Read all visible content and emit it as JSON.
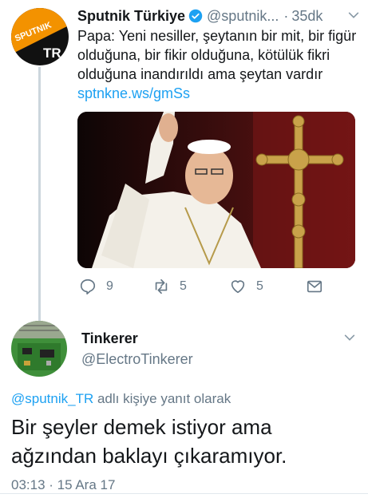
{
  "tweet1": {
    "name": "Sputnik Türkiye",
    "handle": "@sputnik...",
    "time": "35dk",
    "text_main": "Papa: Yeni nesiller, şeytanın bir mit, bir figür olduğuna, bir fikir olduğuna, kötülük fikri olduğuna inandırıldı ama şeytan vardır ",
    "link": "sptnkne.ws/gmSs",
    "avatar_logo_text": "SPUTNIK",
    "avatar_tr": "TR",
    "replies": "9",
    "retweets": "5",
    "likes": "5"
  },
  "tweet2": {
    "name": "Tinkerer",
    "handle": "@ElectroTinkerer",
    "reply_handle": "@sputnik_TR",
    "reply_suffix": " adlı kişiye yanıt olarak",
    "text": "Bir şeyler demek istiyor ama ağzından baklayı çıkaramıyor.",
    "timestamp": "03:13 · 15 Ara 17"
  },
  "colors": {
    "link": "#1da1f2",
    "secondary": "#657786",
    "sputnik_orange": "#f39200",
    "verified": "#1da1f2"
  }
}
